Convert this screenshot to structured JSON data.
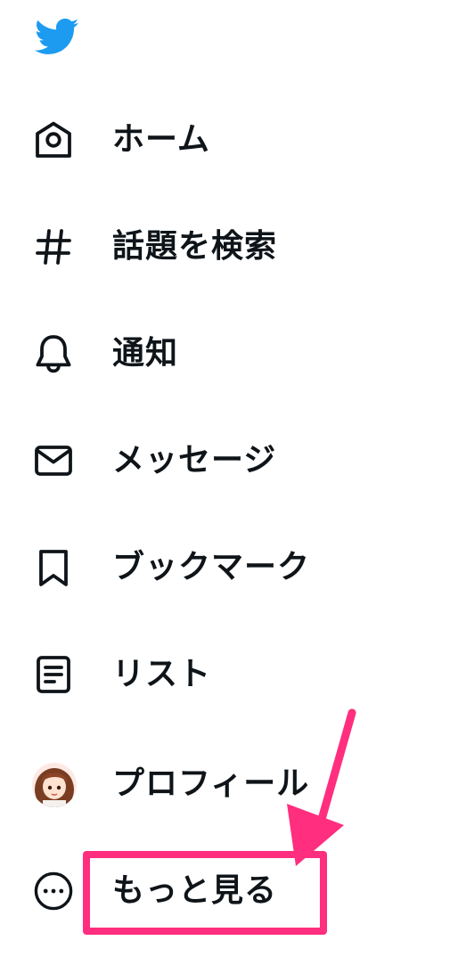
{
  "app": {
    "logo_icon": "twitter-bird-icon",
    "brand_color": "#1d9bf0"
  },
  "nav": {
    "items": [
      {
        "label": "ホーム",
        "icon": "home-icon"
      },
      {
        "label": "話題を検索",
        "icon": "hashtag-icon"
      },
      {
        "label": "通知",
        "icon": "bell-icon"
      },
      {
        "label": "メッセージ",
        "icon": "envelope-icon"
      },
      {
        "label": "ブックマーク",
        "icon": "bookmark-icon"
      },
      {
        "label": "リスト",
        "icon": "list-icon"
      },
      {
        "label": "プロフィール",
        "icon": "avatar"
      },
      {
        "label": "もっと見る",
        "icon": "more-circle-icon"
      }
    ]
  },
  "annotation": {
    "highlight_color": "#ff2e7e"
  }
}
